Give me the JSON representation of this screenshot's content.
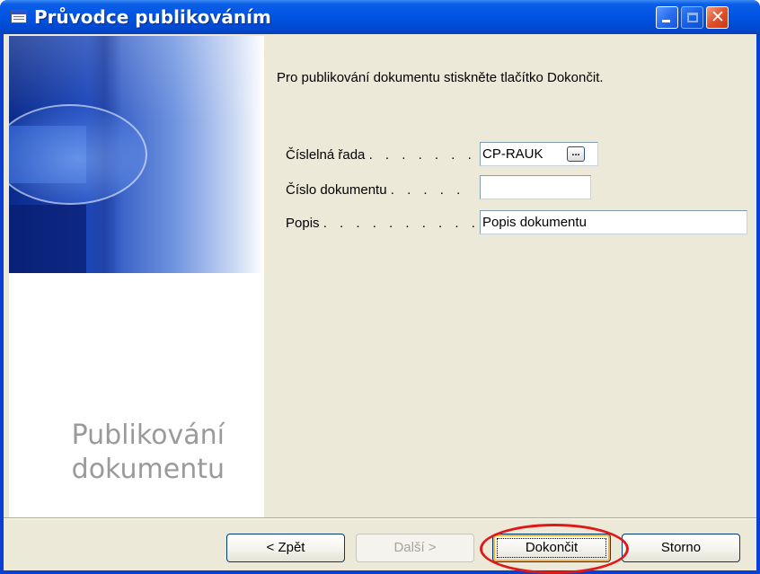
{
  "window": {
    "title": "Průvodce publikováním"
  },
  "sidebar": {
    "heading_line1": "Publikování",
    "heading_line2": "dokumentu"
  },
  "main": {
    "instruction": "Pro publikování dokumentu stiskněte tlačítko Dokončit.",
    "fields": [
      {
        "label": "Číslelná řada",
        "dots": ". . . . . . .",
        "value": "CP-RAUK",
        "lookup_icon": "ellipsis-lookup-icon"
      },
      {
        "label": "Číslo dokumentu",
        "dots": ". . . . .",
        "value": ""
      },
      {
        "label": "Popis",
        "dots": ". . . . . . . . . . .",
        "value": "Popis dokumentu"
      }
    ]
  },
  "buttons": {
    "back": "< Zpět",
    "next": "Další >",
    "finish": "Dokončit",
    "cancel": "Storno"
  },
  "annotation": {
    "highlight_color": "#e01818",
    "highlighted_button": "Dokončit"
  }
}
